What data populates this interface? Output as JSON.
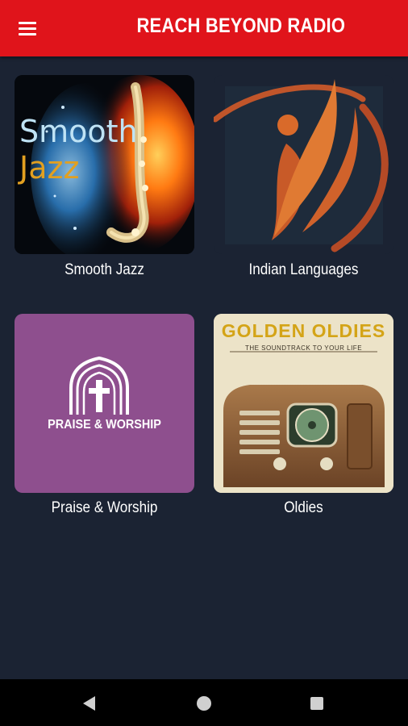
{
  "app_title": "REACH BEYOND RADIO",
  "channels": [
    {
      "label": "Smooth Jazz",
      "art_text_1": "Smooth",
      "art_text_2": "Jazz"
    },
    {
      "label": "Indian Languages"
    },
    {
      "label": "Praise & Worship",
      "art_text": "PRAISE & WORSHIP",
      "art_color": "#8e4f8e"
    },
    {
      "label": "Oldies",
      "art_title": "GOLDEN OLDIES",
      "art_subtitle": "THE SOUNDTRACK TO YOUR LIFE"
    }
  ],
  "colors": {
    "appbar": "#e0141b",
    "background": "#1b2333",
    "accent_orange": "#d96a2a"
  },
  "icons": {
    "menu": "menu-icon",
    "back": "back-icon",
    "home": "home-icon",
    "recents": "recents-icon"
  }
}
